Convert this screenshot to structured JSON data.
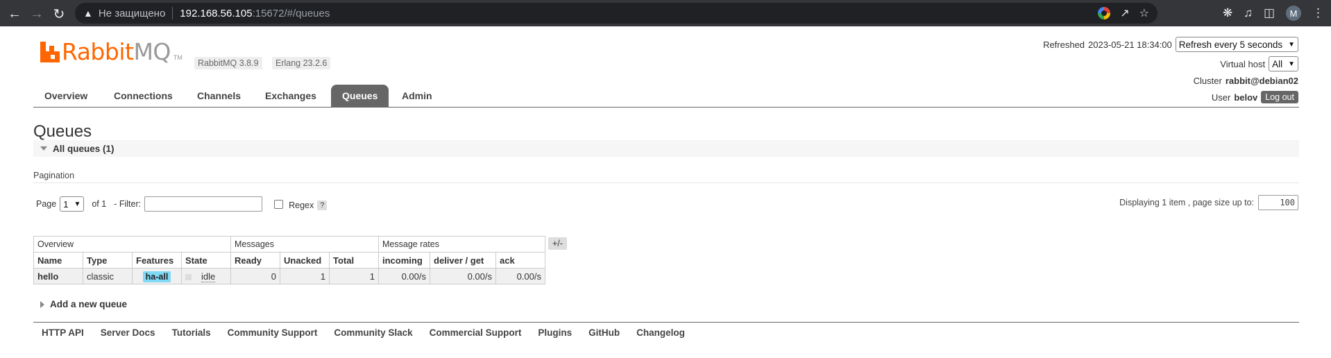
{
  "browser": {
    "insecure_label": "Не защищено",
    "url_host": "192.168.56.105",
    "url_path": ":15672/#/queues",
    "avatar_letter": "M"
  },
  "header": {
    "logo_rabbit": "Rabbit",
    "logo_mq": "MQ",
    "logo_tm": "TM",
    "rabbitmq_version": "RabbitMQ 3.8.9",
    "erlang_version": "Erlang 23.2.6",
    "refreshed_label": "Refreshed",
    "refreshed_time": "2023-05-21 18:34:00",
    "refresh_option": "Refresh every 5 seconds",
    "vhost_label": "Virtual host",
    "vhost_value": "All",
    "cluster_label": "Cluster",
    "cluster_value": "rabbit@debian02",
    "user_label": "User",
    "user_value": "belov",
    "logout_label": "Log out"
  },
  "tabs": [
    {
      "label": "Overview"
    },
    {
      "label": "Connections"
    },
    {
      "label": "Channels"
    },
    {
      "label": "Exchanges"
    },
    {
      "label": "Queues"
    },
    {
      "label": "Admin"
    }
  ],
  "active_tab": "Queues",
  "page_title": "Queues",
  "section_title": "All queues (1)",
  "pagination": {
    "label": "Pagination",
    "page_label": "Page",
    "page_value": "1",
    "of_label": "of 1",
    "filter_label": "- Filter:",
    "filter_value": "",
    "regex_label": "Regex",
    "help_label": "?",
    "display_label": "Displaying 1 item , page size up to:",
    "page_size": "100"
  },
  "table": {
    "groups": [
      "Overview",
      "Messages",
      "Message rates"
    ],
    "columns": [
      "Name",
      "Type",
      "Features",
      "State",
      "Ready",
      "Unacked",
      "Total",
      "incoming",
      "deliver / get",
      "ack"
    ],
    "rows": [
      {
        "name": "hello",
        "type": "classic",
        "features": "ha-all",
        "state": "idle",
        "ready": "0",
        "unacked": "1",
        "total": "1",
        "incoming": "0.00/s",
        "deliver_get": "0.00/s",
        "ack": "0.00/s"
      }
    ],
    "toggle_label": "+/-"
  },
  "add_queue_label": "Add a new queue",
  "footer_links": [
    "HTTP API",
    "Server Docs",
    "Tutorials",
    "Community Support",
    "Community Slack",
    "Commercial Support",
    "Plugins",
    "GitHub",
    "Changelog"
  ],
  "colors": {
    "brand_orange": "#ff6600",
    "active_tab_bg": "#666666",
    "policy_badge": "#80d9f5"
  }
}
